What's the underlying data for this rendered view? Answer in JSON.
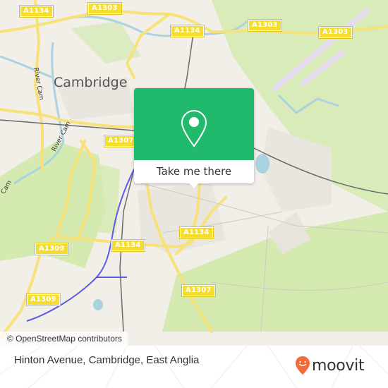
{
  "map": {
    "place_label": "Cambridge",
    "river_labels": [
      "River Cam",
      "River Cam",
      "Cam"
    ],
    "road_labels": [
      {
        "id": "a1134-nw",
        "text": "A1134"
      },
      {
        "id": "a1303-n",
        "text": "A1303"
      },
      {
        "id": "a1134-ne",
        "text": "A1134"
      },
      {
        "id": "a1303-ne1",
        "text": "A1303"
      },
      {
        "id": "a1303-ne2",
        "text": "A1303"
      },
      {
        "id": "a1307-w",
        "text": "A1307"
      },
      {
        "id": "a1134-center",
        "text": "A1134"
      },
      {
        "id": "a1309-w1",
        "text": "A1309"
      },
      {
        "id": "a1134-sw",
        "text": "A1134"
      },
      {
        "id": "a1307-s",
        "text": "A1307"
      },
      {
        "id": "a1309-w2",
        "text": "A1309"
      }
    ],
    "attribution": "© OpenStreetMap contributors",
    "colors": {
      "land": "#f2efe9",
      "green": "#d4eab0",
      "water": "#aad3df",
      "road": "#f7e27a",
      "road_label": "#f5dd2e",
      "rail": "#6b6b6b",
      "transit_line": "#5b5be6",
      "airport": "#e6dcf0"
    }
  },
  "popup": {
    "icon": "map-pin-icon",
    "action_label": "Take me there",
    "color": "#21b96b"
  },
  "footer": {
    "address": "Hinton Avenue, Cambridge, East Anglia",
    "brand": "moovit",
    "brand_color": "#f26b3a"
  }
}
